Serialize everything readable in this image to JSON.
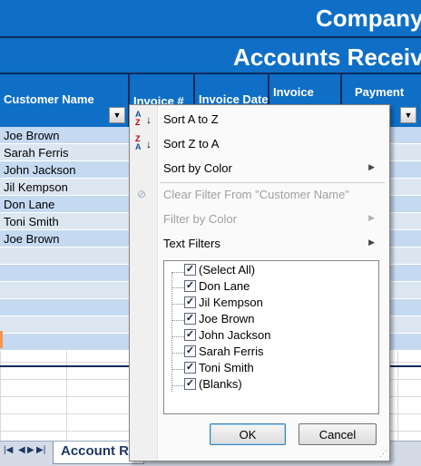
{
  "title": {
    "company": "Company",
    "report": "Accounts Receiva"
  },
  "headers": [
    {
      "label": "Customer Name"
    },
    {
      "label": "Invoice #"
    },
    {
      "label": "Invoice Date"
    },
    {
      "label": "Invoice"
    },
    {
      "label": "Payment"
    }
  ],
  "rows": [
    "Joe Brown",
    "Sarah Ferris",
    "John Jackson",
    "Jil Kempson",
    "Don Lane",
    "Toni Smith",
    "Joe Brown",
    "",
    "",
    "",
    "",
    "",
    "",
    ""
  ],
  "row_zero": "0",
  "sheet_tab": "Account Re",
  "filter_menu": {
    "sort_az": "Sort A to Z",
    "sort_za": "Sort Z to A",
    "sort_color": "Sort by Color",
    "clear_filter": "Clear Filter From \"Customer Name\"",
    "filter_color": "Filter by Color",
    "text_filters": "Text Filters",
    "checklist": [
      "(Select All)",
      "Don Lane",
      "Jil Kempson",
      "Joe Brown",
      "John Jackson",
      "Sarah Ferris",
      "Toni Smith",
      "(Blanks)"
    ],
    "ok": "OK",
    "cancel": "Cancel"
  },
  "colors": {
    "header_blue": "#0f6fc6",
    "row_band_a": "#c5d9f1",
    "row_band_b": "#dce6f1"
  }
}
